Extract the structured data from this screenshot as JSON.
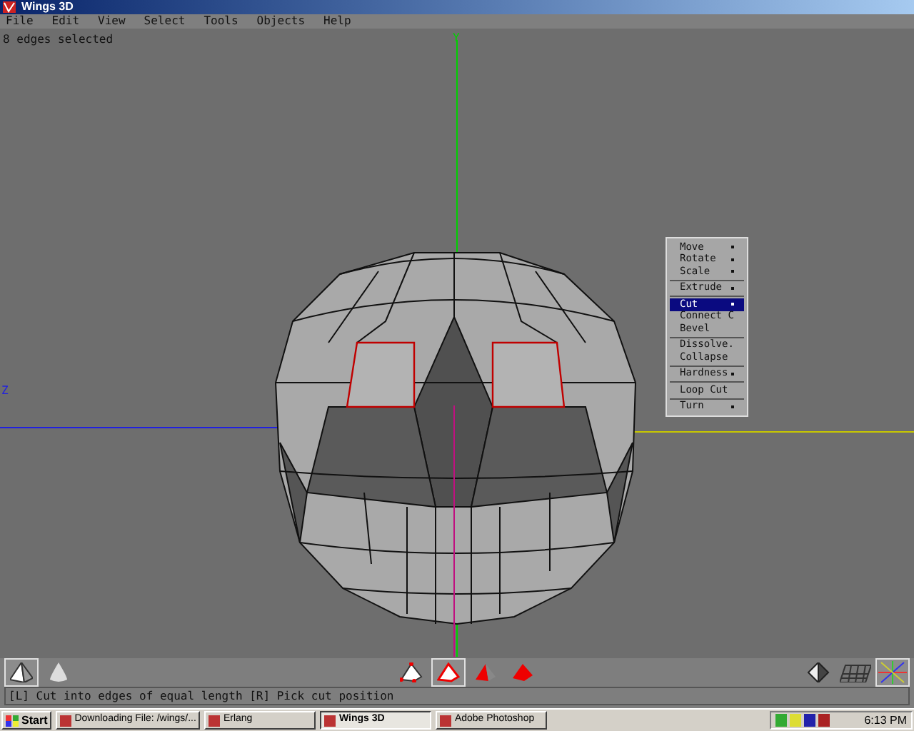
{
  "window": {
    "title": "Wings 3D"
  },
  "menu_bar": [
    "File",
    "Edit",
    "View",
    "Select",
    "Tools",
    "Objects",
    "Help"
  ],
  "viewport": {
    "message": "8 edges selected",
    "axis_labels": [
      {
        "label": "Y",
        "kind": "y"
      },
      {
        "label": "Z",
        "kind": "z"
      }
    ]
  },
  "context_menu": {
    "groups": [
      [
        {
          "label": "Move",
          "submenu": true,
          "selected": false
        },
        {
          "label": "Rotate",
          "submenu": true,
          "selected": false
        },
        {
          "label": "Scale",
          "submenu": true,
          "selected": false
        }
      ],
      [
        {
          "label": "Extrude",
          "submenu": true,
          "selected": false
        }
      ],
      [
        {
          "label": "Cut",
          "submenu": true,
          "selected": true
        },
        {
          "label": "Connect",
          "hotkey": "C",
          "submenu": false,
          "selected": false
        },
        {
          "label": "Bevel",
          "submenu": false,
          "selected": false
        }
      ],
      [
        {
          "label": "Dissolve",
          "hotkey": ".",
          "submenu": false,
          "selected": false
        },
        {
          "label": "Collapse",
          "submenu": false,
          "selected": false
        }
      ],
      [
        {
          "label": "Hardness",
          "submenu": true,
          "selected": false
        }
      ],
      [
        {
          "label": "Loop Cut",
          "submenu": false,
          "selected": false
        }
      ],
      [
        {
          "label": "Turn",
          "submenu": true,
          "selected": false
        }
      ]
    ]
  },
  "toolbar": {
    "left": [
      {
        "kind": "flat",
        "selected": true
      },
      {
        "kind": "smooth",
        "selected": false
      }
    ],
    "select_modes": [
      {
        "kind": "vertex",
        "selected": false
      },
      {
        "kind": "edge",
        "selected": true
      },
      {
        "kind": "face",
        "selected": false
      },
      {
        "kind": "body",
        "selected": false
      }
    ],
    "right": [
      {
        "kind": "cube",
        "selected": false
      },
      {
        "kind": "grid",
        "selected": false
      },
      {
        "kind": "axes",
        "selected": true
      }
    ]
  },
  "info_line": "[L] Cut into edges of equal length  [R] Pick cut position",
  "taskbar": {
    "start": "Start",
    "tasks": [
      {
        "label": "Downloading File: /wings/...",
        "selected": false
      },
      {
        "label": "Erlang",
        "selected": false
      },
      {
        "label": "Wings 3D",
        "selected": true
      },
      {
        "label": "Adobe Photoshop",
        "selected": false
      }
    ],
    "clock": "6:13 PM"
  }
}
